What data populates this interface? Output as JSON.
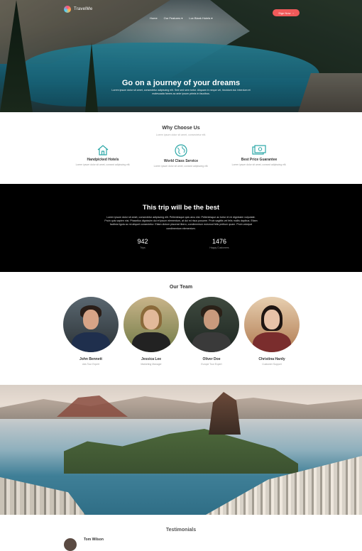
{
  "nav": {
    "brand": "TravelMe",
    "menu": [
      "Home",
      "Our Features ▾",
      "Lux Blank Hotels ▾"
    ],
    "cta_label": "Sign Now",
    "cta_icon": "arrow-right-icon"
  },
  "hero": {
    "title": "Go on a journey of your dreams",
    "subtitle": "Lorem ipsum dolor sit amet, consectetur adipiscing elit. Sed sed sem tortor. Aliquam in neque vel, tincidunt dui. Interdum et malesuada fames ac ante ipsum primis in faucibus."
  },
  "why": {
    "title": "Why Choose Us",
    "subtitle": "Lorem ipsum dolor sit amet, consectetur elit.",
    "accent": "#2aa6a6",
    "features": [
      {
        "icon": "home-icon",
        "title": "Handpicked Hotels",
        "desc": "Lorem ipsum dolor sit amet, consect adipiscing elit."
      },
      {
        "icon": "globe-icon",
        "title": "World Class Service",
        "desc": "Lorem ipsum dolor sit amet, consect adipiscing elit."
      },
      {
        "icon": "money-icon",
        "title": "Best Price Guarantee",
        "desc": "Lorem ipsum dolor sit amet, consect adipiscing elit."
      }
    ]
  },
  "trip": {
    "title": "This trip will be the best",
    "text": "Lorem ipsum dolor sit amet, consectetur adipiscing elit. Pellentesque quis arcu nisl. Pellentesque ac tortor et mi dignissim vulputate. Proin quis sapien nisi. Phasellus dignissim dui et ipsum elementum, at dui mi risus posuere. Proin sagittis vel felis mollis dapibus. Etiam facilisis ligula ac mi aliquet consectetur. Etiam dictum placerat libero, condimentum euismod felis pretium quam. Proin volutpat condimentum elementum.",
    "stats": [
      {
        "value": "942",
        "label": "Trips"
      },
      {
        "value": "1476",
        "label": "Happy Customers"
      }
    ]
  },
  "team": {
    "title": "Our Team",
    "members": [
      {
        "name": "John Bennett",
        "role": "Ads Tour Expert"
      },
      {
        "name": "Jessica Lee",
        "role": "Marketing Manager"
      },
      {
        "name": "Oliver Doe",
        "role": "Europe Tour Expert"
      },
      {
        "name": "Christina Hardy",
        "role": "Customer Support"
      }
    ]
  },
  "testimonials": {
    "title": "Testimonials",
    "first_name": "Tom Wilson"
  }
}
